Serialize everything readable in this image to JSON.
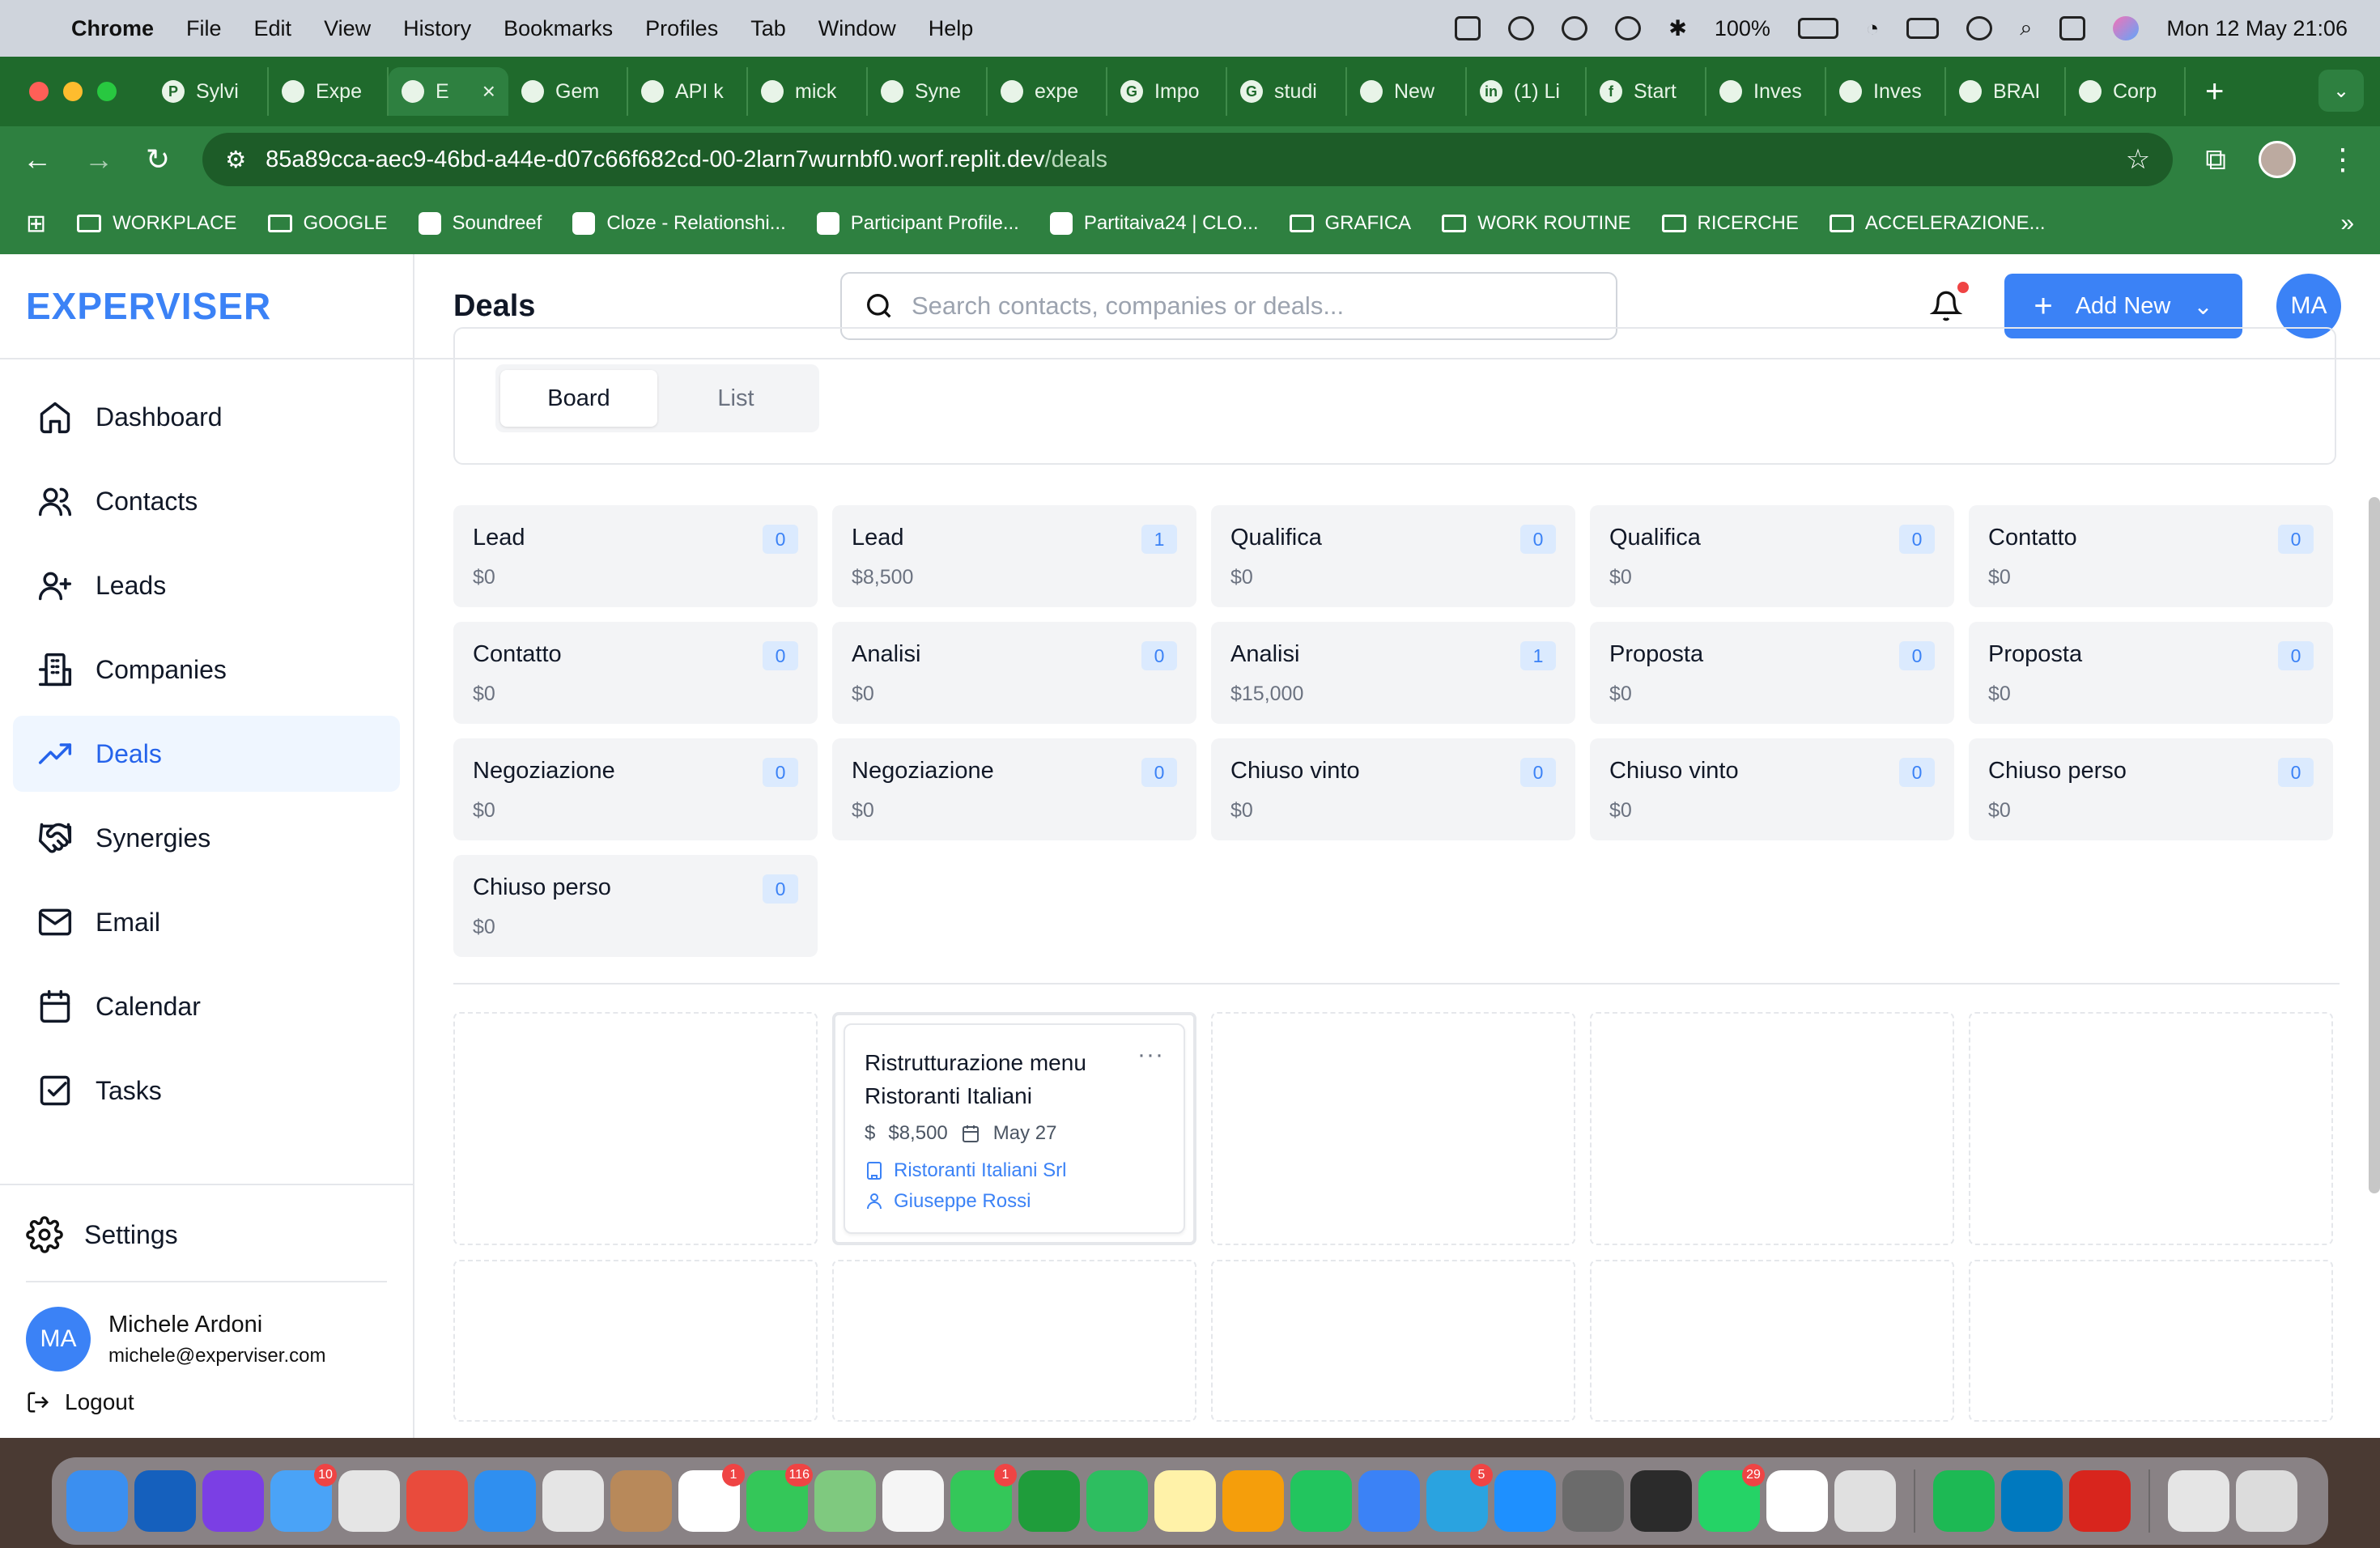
{
  "menubar": {
    "app": "Chrome",
    "items": [
      "File",
      "Edit",
      "View",
      "History",
      "Bookmarks",
      "Profiles",
      "Tab",
      "Window",
      "Help"
    ],
    "battery": "100%",
    "datetime": "Mon 12 May  21:06"
  },
  "tabs": [
    {
      "label": "Sylvi",
      "fav": "P"
    },
    {
      "label": "Expe",
      "fav": ""
    },
    {
      "label": "E",
      "fav": "",
      "active": true
    },
    {
      "label": "Gem",
      "fav": ""
    },
    {
      "label": "API k",
      "fav": ""
    },
    {
      "label": "mick",
      "fav": ""
    },
    {
      "label": "Syne",
      "fav": ""
    },
    {
      "label": "expe",
      "fav": ""
    },
    {
      "label": "Impo",
      "fav": "G"
    },
    {
      "label": "studi",
      "fav": "G"
    },
    {
      "label": "New",
      "fav": ""
    },
    {
      "label": "(1) Li",
      "fav": "in"
    },
    {
      "label": "Start",
      "fav": "f"
    },
    {
      "label": "Inves",
      "fav": ""
    },
    {
      "label": "Inves",
      "fav": ""
    },
    {
      "label": "BRAI",
      "fav": ""
    },
    {
      "label": "Corp",
      "fav": ""
    }
  ],
  "omnibox": {
    "host": "85a89cca-aec9-46bd-a44e-d07c66f682cd-00-2larn7wurnbf0.worf.replit.dev",
    "path": "/deals"
  },
  "bookmarks": [
    {
      "label": "WORKPLACE",
      "kind": "folder"
    },
    {
      "label": "GOOGLE",
      "kind": "folder"
    },
    {
      "label": "Soundreef",
      "kind": "site"
    },
    {
      "label": "Cloze - Relationshi...",
      "kind": "site"
    },
    {
      "label": "Participant Profile...",
      "kind": "site"
    },
    {
      "label": "Partitaiva24 | CLO...",
      "kind": "site"
    },
    {
      "label": "GRAFICA",
      "kind": "folder"
    },
    {
      "label": "WORK ROUTINE",
      "kind": "folder"
    },
    {
      "label": "RICERCHE",
      "kind": "folder"
    },
    {
      "label": "ACCELERAZIONE...",
      "kind": "folder"
    }
  ],
  "sidebar": {
    "brand": "EXPERVISER",
    "items": [
      {
        "label": "Dashboard",
        "icon": "home-icon"
      },
      {
        "label": "Contacts",
        "icon": "users-icon"
      },
      {
        "label": "Leads",
        "icon": "user-plus-icon"
      },
      {
        "label": "Companies",
        "icon": "building-icon"
      },
      {
        "label": "Deals",
        "icon": "trending-up-icon",
        "active": true
      },
      {
        "label": "Synergies",
        "icon": "handshake-icon"
      },
      {
        "label": "Email",
        "icon": "mail-icon"
      },
      {
        "label": "Calendar",
        "icon": "calendar-icon"
      },
      {
        "label": "Tasks",
        "icon": "check-square-icon"
      }
    ],
    "settings": "Settings",
    "user": {
      "initials": "MA",
      "name": "Michele Ardoni",
      "email": "michele@experviser.com"
    },
    "logout": "Logout"
  },
  "header": {
    "title": "Deals",
    "search_placeholder": "Search contacts, companies or deals...",
    "add_new": "Add New",
    "avatar": "MA"
  },
  "view_toggle": {
    "board": "Board",
    "list": "List",
    "selected": "Board"
  },
  "stages": [
    {
      "name": "Lead",
      "value": "$0",
      "count": "0"
    },
    {
      "name": "Lead",
      "value": "$8,500",
      "count": "1"
    },
    {
      "name": "Qualifica",
      "value": "$0",
      "count": "0"
    },
    {
      "name": "Qualifica",
      "value": "$0",
      "count": "0"
    },
    {
      "name": "Contatto",
      "value": "$0",
      "count": "0"
    },
    {
      "name": "Contatto",
      "value": "$0",
      "count": "0"
    },
    {
      "name": "Analisi",
      "value": "$0",
      "count": "0"
    },
    {
      "name": "Analisi",
      "value": "$15,000",
      "count": "1"
    },
    {
      "name": "Proposta",
      "value": "$0",
      "count": "0"
    },
    {
      "name": "Proposta",
      "value": "$0",
      "count": "0"
    },
    {
      "name": "Negoziazione",
      "value": "$0",
      "count": "0"
    },
    {
      "name": "Negoziazione",
      "value": "$0",
      "count": "0"
    },
    {
      "name": "Chiuso vinto",
      "value": "$0",
      "count": "0"
    },
    {
      "name": "Chiuso vinto",
      "value": "$0",
      "count": "0"
    },
    {
      "name": "Chiuso perso",
      "value": "$0",
      "count": "0"
    },
    {
      "name": "Chiuso perso",
      "value": "$0",
      "count": "0"
    }
  ],
  "deal": {
    "title": "Ristrutturazione menu Ristoranti Italiani",
    "amount": "$8,500",
    "date": "May 27",
    "company": "Ristoranti Italiani Srl",
    "contact": "Giuseppe Rossi",
    "menu": "···"
  },
  "dock": [
    {
      "name": "finder",
      "color": "#3b8ff0"
    },
    {
      "name": "outlook",
      "color": "#1560bd"
    },
    {
      "name": "siri",
      "color": "#7b3fe4"
    },
    {
      "name": "mail",
      "color": "#4aa3f7",
      "badge": "10"
    },
    {
      "name": "launchpad",
      "color": "#e5e5e5"
    },
    {
      "name": "chrome",
      "color": "#e94b3c"
    },
    {
      "name": "safari",
      "color": "#2f8ff0"
    },
    {
      "name": "opera",
      "color": "#e5e5e5"
    },
    {
      "name": "contacts",
      "color": "#b8895a"
    },
    {
      "name": "calendar",
      "color": "#ffffff",
      "badge": "1"
    },
    {
      "name": "messages",
      "color": "#34c759",
      "badge": "116"
    },
    {
      "name": "maps",
      "color": "#7fc97f"
    },
    {
      "name": "photos",
      "color": "#f5f5f5"
    },
    {
      "name": "facetime",
      "color": "#34c759",
      "badge": "1"
    },
    {
      "name": "chat",
      "color": "#1f9d3b"
    },
    {
      "name": "evernote",
      "color": "#2dbe60"
    },
    {
      "name": "notes",
      "color": "#fff2a8"
    },
    {
      "name": "pages",
      "color": "#f59e0b"
    },
    {
      "name": "numbers",
      "color": "#22c55e"
    },
    {
      "name": "keynote",
      "color": "#3b82f6"
    },
    {
      "name": "telegram",
      "color": "#2aa3e0",
      "badge": "5"
    },
    {
      "name": "appstore",
      "color": "#1e90ff"
    },
    {
      "name": "settings",
      "color": "#6b6b6b"
    },
    {
      "name": "phone",
      "color": "#2b2b2b"
    },
    {
      "name": "whatsapp",
      "color": "#25d366",
      "badge": "29"
    },
    {
      "name": "chatgpt",
      "color": "#ffffff"
    },
    {
      "name": "iphone-mirroring",
      "color": "#e0e0e0"
    },
    {
      "name": "spotify",
      "color": "#1db954"
    },
    {
      "name": "trello",
      "color": "#0079bf"
    },
    {
      "name": "acrobat",
      "color": "#d8251d"
    },
    {
      "name": "downloads",
      "color": "#e5e5e5"
    },
    {
      "name": "trash",
      "color": "#dcdcdc"
    }
  ]
}
